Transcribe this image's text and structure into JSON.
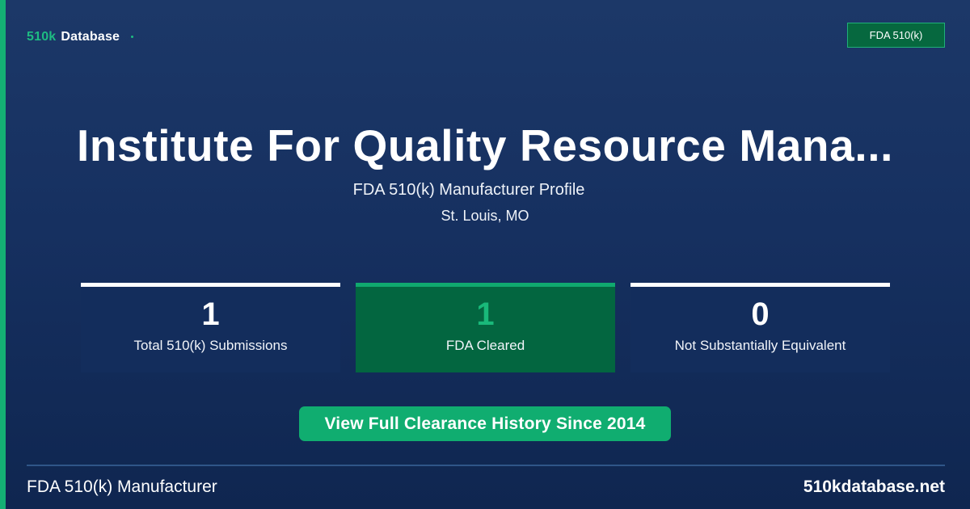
{
  "brand": {
    "part1": "510k",
    "part2": "Database"
  },
  "badge": {
    "label": "FDA 510(k)"
  },
  "header": {
    "title": "Institute For Quality Resource Mana...",
    "subtitle": "FDA 510(k) Manufacturer Profile",
    "location": "St. Louis, MO"
  },
  "stats": [
    {
      "value": "1",
      "label": "Total 510(k) Submissions"
    },
    {
      "value": "1",
      "label": "FDA Cleared"
    },
    {
      "value": "0",
      "label": "Not Substantially Equivalent"
    }
  ],
  "cta": {
    "label": "View Full Clearance History Since 2014"
  },
  "footer": {
    "left": "FDA 510(k) Manufacturer",
    "right": "510kdatabase.net"
  },
  "colors": {
    "accent": "#14b074",
    "background": "#163060",
    "card": "#132d5c",
    "card_highlight": "#036640"
  }
}
